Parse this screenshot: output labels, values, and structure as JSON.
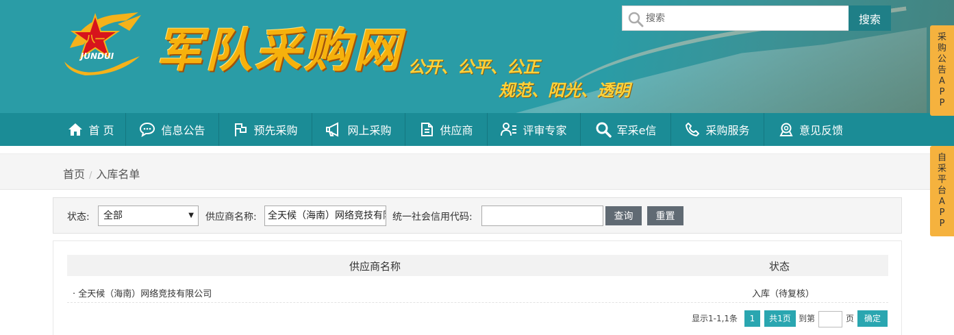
{
  "header": {
    "emblem_text": "JUNDUI",
    "site_title": "军队采购网",
    "slogan_line1": "公开、公平、公正",
    "slogan_line2": "规范、阳光、透明",
    "search_placeholder": "搜索",
    "search_button": "搜索"
  },
  "nav": {
    "items": [
      {
        "label": "首 页",
        "icon": "home-icon"
      },
      {
        "label": "信息公告",
        "icon": "chat-icon"
      },
      {
        "label": "预先采购",
        "icon": "flag-icon"
      },
      {
        "label": "网上采购",
        "icon": "megaphone-icon"
      },
      {
        "label": "供应商",
        "icon": "document-icon"
      },
      {
        "label": "评审专家",
        "icon": "expert-icon"
      },
      {
        "label": "军采e信",
        "icon": "search-icon"
      },
      {
        "label": "采购服务",
        "icon": "phone-icon"
      },
      {
        "label": "意见反馈",
        "icon": "feedback-icon"
      }
    ]
  },
  "side_tabs": {
    "app": "采购公告APP",
    "platform": "自采平台APP"
  },
  "breadcrumb": {
    "home": "首页",
    "separator": "/",
    "current": "入库名单"
  },
  "filter": {
    "status_label": "状态:",
    "status_value": "全部",
    "supplier_label": "供应商名称:",
    "supplier_value": "全天候（海南）网络竞技有限公司",
    "credit_label": "统一社会信用代码:",
    "credit_value": "",
    "query_button": "查询",
    "reset_button": "重置"
  },
  "table": {
    "columns": [
      "供应商名称",
      "状态"
    ],
    "rows": [
      {
        "name": "· 全天候（海南）网络竞技有限公司",
        "status": "入库（待复核）"
      }
    ]
  },
  "pagination": {
    "summary": "显示1-1,1条",
    "current_page": "1",
    "total": "共1页",
    "goto_label": "到第",
    "page_unit": "页",
    "confirm": "确定"
  }
}
